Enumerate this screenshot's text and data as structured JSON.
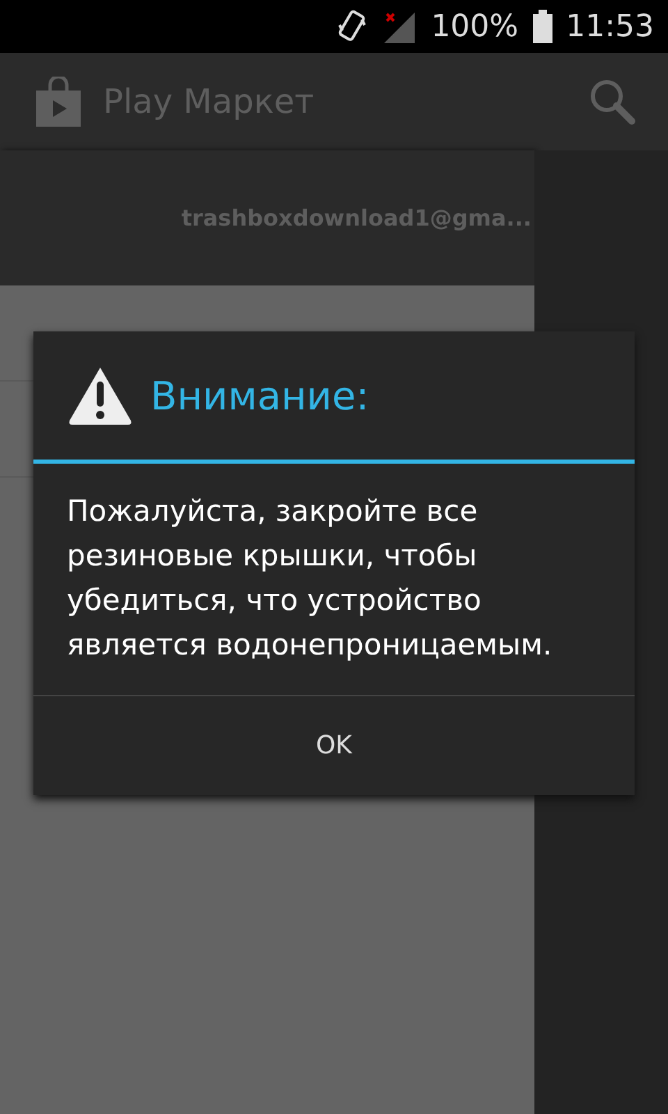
{
  "status_bar": {
    "battery": "100%",
    "time": "11:53"
  },
  "action_bar": {
    "title": "Play Маркет"
  },
  "drawer": {
    "account": "trashboxdownload1@gma..."
  },
  "dialog": {
    "title": "Внимание:",
    "message": "Пожалуйста, закройте все резиновые крышки, чтобы убедиться, что устройство является водонепроницаемым.",
    "buttons": [
      "OK"
    ]
  }
}
